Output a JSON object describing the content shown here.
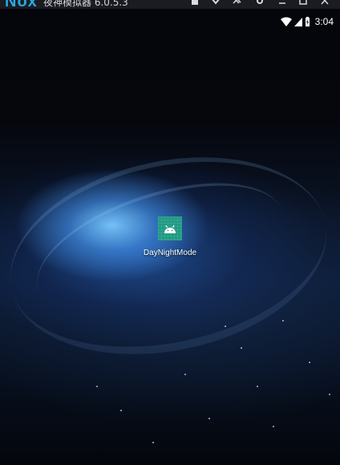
{
  "emulator": {
    "logo": "Nox",
    "title": "夜神模拟器 6.0.5.3",
    "controls": [
      "shirt-icon",
      "chevron-down-icon",
      "pin-icon",
      "gear-icon",
      "minimize-icon",
      "maximize-icon",
      "close-icon"
    ]
  },
  "statusbar": {
    "icons": [
      "wifi-icon",
      "cell-signal-icon",
      "battery-charging-icon"
    ],
    "time": "3:04"
  },
  "home": {
    "apps": [
      {
        "label": "DayNightMode",
        "icon": "android-icon",
        "icon_color": "#1f9a83"
      }
    ]
  }
}
